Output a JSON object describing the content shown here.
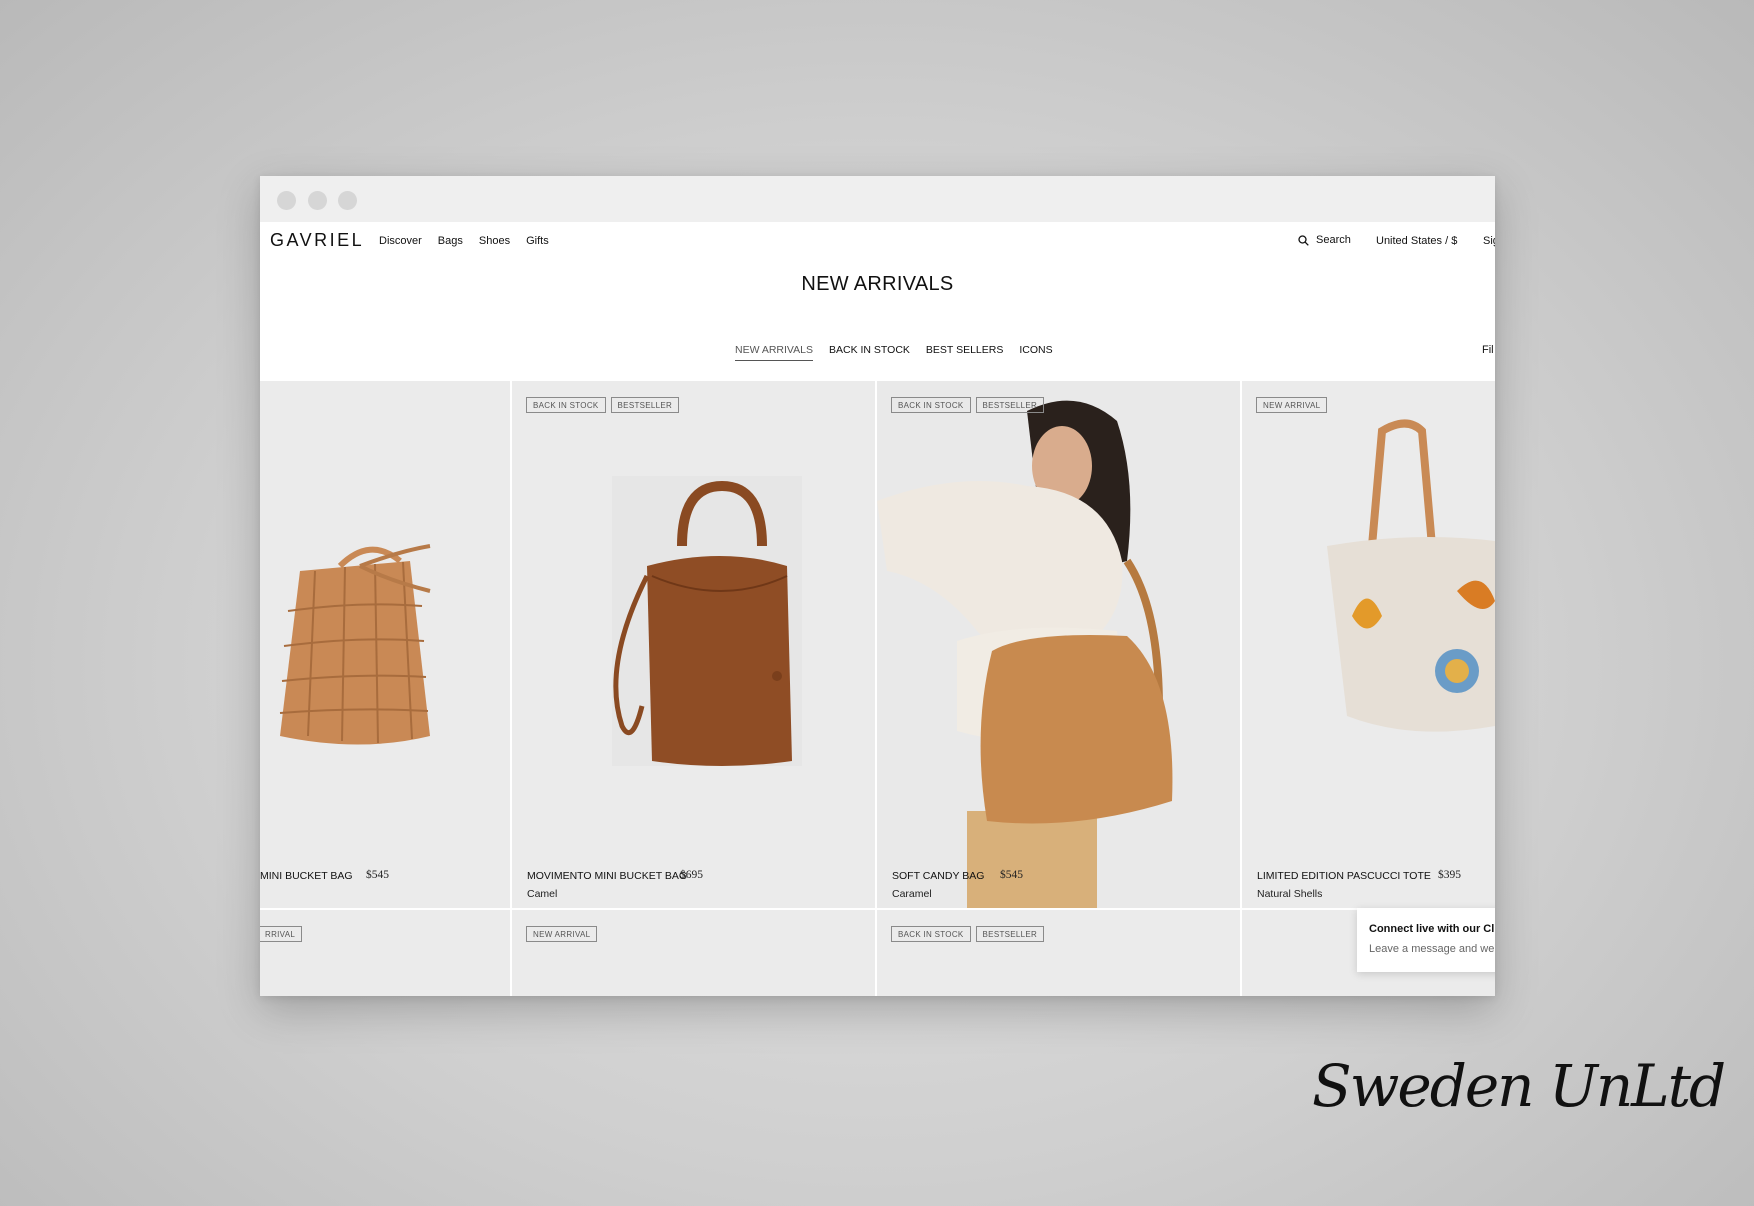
{
  "header": {
    "logo": "GAVRIEL",
    "nav": [
      "Discover",
      "Bags",
      "Shoes",
      "Gifts"
    ],
    "search_label": "Search",
    "locale": "United States / $",
    "signin": "Sig"
  },
  "page": {
    "title": "NEW ARRIVALS",
    "subnav": [
      "NEW ARRIVALS",
      "BACK IN STOCK",
      "BEST SELLERS",
      "ICONS"
    ],
    "filter_label": "Fil"
  },
  "products": [
    {
      "name": "MINI BUCKET BAG",
      "price": "$545",
      "color": "",
      "badges": []
    },
    {
      "name": "MOVIMENTO MINI BUCKET BAG",
      "price": "$695",
      "color": "Camel",
      "badges": [
        "BACK IN STOCK",
        "BESTSELLER"
      ]
    },
    {
      "name": "SOFT CANDY BAG",
      "price": "$545",
      "color": "Caramel",
      "badges": [
        "BACK IN STOCK",
        "BESTSELLER"
      ]
    },
    {
      "name": "LIMITED EDITION PASCUCCI TOTE",
      "price": "$395",
      "color": "Natural Shells",
      "badges": [
        "NEW ARRIVAL"
      ]
    }
  ],
  "row2_badges": [
    [
      "RRIVAL"
    ],
    [
      "NEW ARRIVAL"
    ],
    [
      "BACK IN STOCK",
      "BESTSELLER"
    ]
  ],
  "chat": {
    "title": "Connect live with our Cli",
    "subtitle": "Leave a message and we'"
  },
  "watermark": "Sweden UnLtd",
  "colors": {
    "card_bg": "#ebebeb",
    "accent_leather": "#c98a55",
    "text": "#111111"
  }
}
